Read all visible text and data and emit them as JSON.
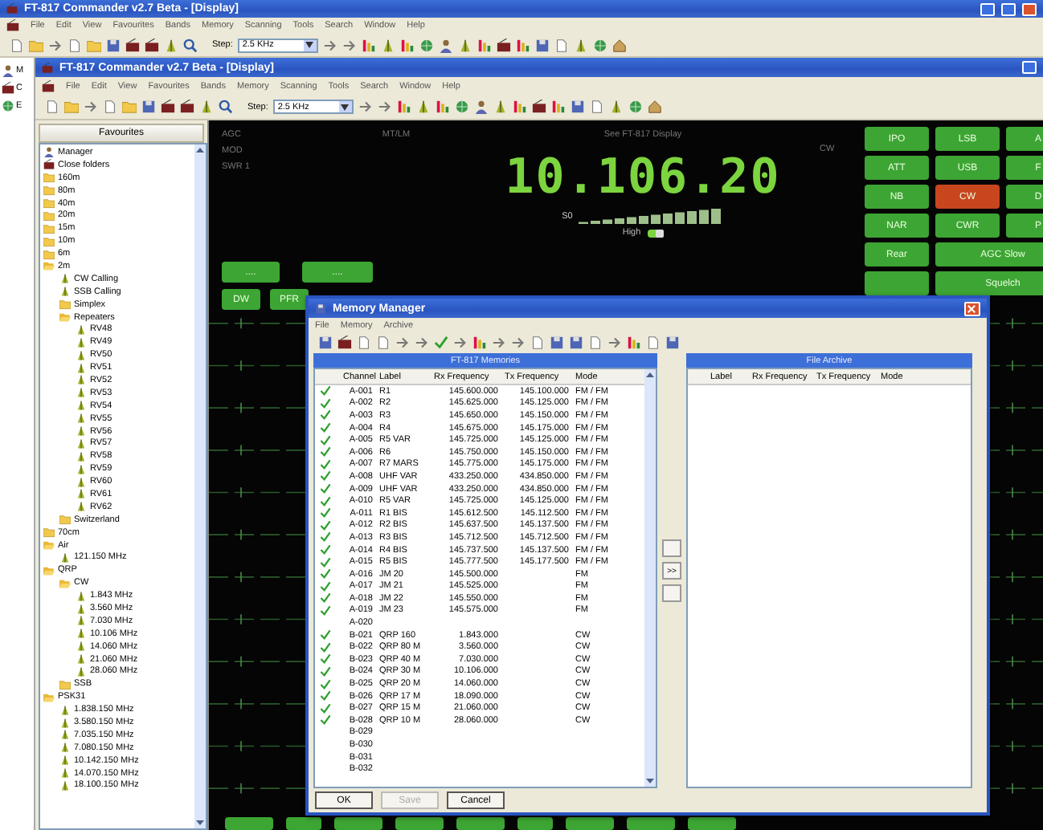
{
  "outer_window": {
    "title": "FT-817 Commander v2.7 Beta - [Display]",
    "menu": [
      "File",
      "Edit",
      "View",
      "Favourites",
      "Bands",
      "Memory",
      "Scanning",
      "Tools",
      "Search",
      "Window",
      "Help"
    ],
    "step": {
      "label": "Step:",
      "value": "2.5 KHz"
    }
  },
  "side_strip": [
    "M",
    "C",
    "E"
  ],
  "inner_window": {
    "title": "FT-817 Commander v2.7 Beta - [Display]",
    "menu": [
      "File",
      "Edit",
      "View",
      "Favourites",
      "Bands",
      "Memory",
      "Scanning",
      "Tools",
      "Search",
      "Window",
      "Help"
    ],
    "step": {
      "label": "Step:",
      "value": "2.5 KHz"
    }
  },
  "favourites": {
    "title": "Favourites",
    "items": [
      {
        "label": "Manager",
        "kind": "manager"
      },
      {
        "label": "Close folders",
        "kind": "action"
      },
      {
        "label": "160m",
        "kind": "folder",
        "expanded": false
      },
      {
        "label": "80m",
        "kind": "folder",
        "expanded": false
      },
      {
        "label": "40m",
        "kind": "folder",
        "expanded": false
      },
      {
        "label": "20m",
        "kind": "folder",
        "expanded": false
      },
      {
        "label": "15m",
        "kind": "folder",
        "expanded": false
      },
      {
        "label": "10m",
        "kind": "folder",
        "expanded": false
      },
      {
        "label": "6m",
        "kind": "folder",
        "expanded": false
      },
      {
        "label": "2m",
        "kind": "folder",
        "expanded": true,
        "children": [
          {
            "label": "CW Calling",
            "kind": "channel"
          },
          {
            "label": "SSB Calling",
            "kind": "channel"
          },
          {
            "label": "Simplex",
            "kind": "folder",
            "expanded": false
          },
          {
            "label": "Repeaters",
            "kind": "folder",
            "expanded": true,
            "children": [
              {
                "label": "RV48",
                "kind": "channel"
              },
              {
                "label": "RV49",
                "kind": "channel"
              },
              {
                "label": "RV50",
                "kind": "channel"
              },
              {
                "label": "RV51",
                "kind": "channel"
              },
              {
                "label": "RV52",
                "kind": "channel"
              },
              {
                "label": "RV53",
                "kind": "channel"
              },
              {
                "label": "RV54",
                "kind": "channel"
              },
              {
                "label": "RV55",
                "kind": "channel"
              },
              {
                "label": "RV56",
                "kind": "channel"
              },
              {
                "label": "RV57",
                "kind": "channel"
              },
              {
                "label": "RV58",
                "kind": "channel"
              },
              {
                "label": "RV59",
                "kind": "channel"
              },
              {
                "label": "RV60",
                "kind": "channel"
              },
              {
                "label": "RV61",
                "kind": "channel"
              },
              {
                "label": "RV62",
                "kind": "channel"
              }
            ]
          },
          {
            "label": "Switzerland",
            "kind": "folder",
            "expanded": false
          }
        ]
      },
      {
        "label": "70cm",
        "kind": "folder",
        "expanded": false
      },
      {
        "label": "Air",
        "kind": "folder",
        "expanded": true,
        "children": [
          {
            "label": "121.150 MHz",
            "kind": "channel"
          }
        ]
      },
      {
        "label": "QRP",
        "kind": "folder",
        "expanded": true,
        "children": [
          {
            "label": "CW",
            "kind": "folder",
            "expanded": true,
            "children": [
              {
                "label": "1.843 MHz",
                "kind": "channel"
              },
              {
                "label": "3.560 MHz",
                "kind": "channel"
              },
              {
                "label": "7.030 MHz",
                "kind": "channel"
              },
              {
                "label": "10.106 MHz",
                "kind": "channel"
              },
              {
                "label": "14.060 MHz",
                "kind": "channel"
              },
              {
                "label": "21.060 MHz",
                "kind": "channel"
              },
              {
                "label": "28.060 MHz",
                "kind": "channel"
              }
            ]
          },
          {
            "label": "SSB",
            "kind": "folder",
            "expanded": false
          }
        ]
      },
      {
        "label": "PSK31",
        "kind": "folder",
        "expanded": true,
        "children": [
          {
            "label": "1.838.150 MHz",
            "kind": "channel"
          },
          {
            "label": "3.580.150 MHz",
            "kind": "channel"
          },
          {
            "label": "7.035.150 MHz",
            "kind": "channel"
          },
          {
            "label": "7.080.150 MHz",
            "kind": "channel"
          },
          {
            "label": "10.142.150 MHz",
            "kind": "channel"
          },
          {
            "label": "14.070.150 MHz",
            "kind": "channel"
          },
          {
            "label": "18.100.150 MHz",
            "kind": "channel"
          }
        ]
      }
    ]
  },
  "display": {
    "labels": [
      "AGC",
      "MOD",
      "SWR 1"
    ],
    "meter_label": "MT/LM",
    "note": "See FT-817 Display",
    "mode": "CW",
    "frequency": "10.106.20",
    "smeter": "S0",
    "power": {
      "label": "High",
      "on": true
    },
    "left_buttons": [
      "....",
      "...."
    ],
    "lower_buttons": [
      "DW",
      "PFR"
    ],
    "function_buttons": [
      {
        "label": "IPO",
        "active": false,
        "wide": false
      },
      {
        "label": "LSB",
        "active": false,
        "wide": false
      },
      {
        "label": "A",
        "active": false,
        "wide": false
      },
      {
        "label": "ATT",
        "active": false,
        "wide": false
      },
      {
        "label": "USB",
        "active": false,
        "wide": false
      },
      {
        "label": "F",
        "active": false,
        "wide": false
      },
      {
        "label": "NB",
        "active": false,
        "wide": false
      },
      {
        "label": "CW",
        "active": true,
        "wide": false
      },
      {
        "label": "D",
        "active": false,
        "wide": false
      },
      {
        "label": "NAR",
        "active": false,
        "wide": false
      },
      {
        "label": "CWR",
        "active": false,
        "wide": false
      },
      {
        "label": "P",
        "active": false,
        "wide": false
      },
      {
        "label": "Rear",
        "active": false,
        "wide": false
      },
      {
        "label": "AGC Slow",
        "active": false,
        "wide": true
      },
      {
        "active": false,
        "wide": false
      },
      {
        "label": "Squelch",
        "active": false,
        "wide": true
      }
    ]
  },
  "memory_manager": {
    "title": "Memory Manager",
    "menu": [
      "File",
      "Memory",
      "Archive"
    ],
    "memories": {
      "title": "FT-817 Memories",
      "columns": [
        "Channel",
        "Label",
        "Rx Frequency",
        "Tx Frequency",
        "Mode"
      ],
      "rows": [
        {
          "checked": true,
          "channel": "A-001",
          "label": "R1",
          "rx": "145.600.000",
          "tx": "145.100.000",
          "mode": "FM / FM"
        },
        {
          "checked": true,
          "channel": "A-002",
          "label": "R2",
          "rx": "145.625.000",
          "tx": "145.125.000",
          "mode": "FM / FM"
        },
        {
          "checked": true,
          "channel": "A-003",
          "label": "R3",
          "rx": "145.650.000",
          "tx": "145.150.000",
          "mode": "FM / FM"
        },
        {
          "checked": true,
          "channel": "A-004",
          "label": "R4",
          "rx": "145.675.000",
          "tx": "145.175.000",
          "mode": "FM / FM"
        },
        {
          "checked": true,
          "channel": "A-005",
          "label": "R5 VAR",
          "rx": "145.725.000",
          "tx": "145.125.000",
          "mode": "FM / FM"
        },
        {
          "checked": true,
          "channel": "A-006",
          "label": "R6",
          "rx": "145.750.000",
          "tx": "145.150.000",
          "mode": "FM / FM"
        },
        {
          "checked": true,
          "channel": "A-007",
          "label": "R7 MARS",
          "rx": "145.775.000",
          "tx": "145.175.000",
          "mode": "FM / FM"
        },
        {
          "checked": true,
          "channel": "A-008",
          "label": "UHF VAR",
          "rx": "433.250.000",
          "tx": "434.850.000",
          "mode": "FM / FM"
        },
        {
          "checked": true,
          "channel": "A-009",
          "label": "UHF VAR",
          "rx": "433.250.000",
          "tx": "434.850.000",
          "mode": "FM / FM"
        },
        {
          "checked": true,
          "channel": "A-010",
          "label": "R5 VAR",
          "rx": "145.725.000",
          "tx": "145.125.000",
          "mode": "FM / FM"
        },
        {
          "checked": true,
          "channel": "A-011",
          "label": "R1 BIS",
          "rx": "145.612.500",
          "tx": "145.112.500",
          "mode": "FM / FM"
        },
        {
          "checked": true,
          "channel": "A-012",
          "label": "R2 BIS",
          "rx": "145.637.500",
          "tx": "145.137.500",
          "mode": "FM / FM"
        },
        {
          "checked": true,
          "channel": "A-013",
          "label": "R3 BIS",
          "rx": "145.712.500",
          "tx": "145.712.500",
          "mode": "FM / FM"
        },
        {
          "checked": true,
          "channel": "A-014",
          "label": "R4 BIS",
          "rx": "145.737.500",
          "tx": "145.137.500",
          "mode": "FM / FM"
        },
        {
          "checked": true,
          "channel": "A-015",
          "label": "R5 BIS",
          "rx": "145.777.500",
          "tx": "145.177.500",
          "mode": "FM / FM"
        },
        {
          "checked": true,
          "channel": "A-016",
          "label": "JM 20",
          "rx": "145.500.000",
          "mode": "FM"
        },
        {
          "checked": true,
          "channel": "A-017",
          "label": "JM 21",
          "rx": "145.525.000",
          "mode": "FM"
        },
        {
          "checked": true,
          "channel": "A-018",
          "label": "JM 22",
          "rx": "145.550.000",
          "mode": "FM"
        },
        {
          "checked": true,
          "channel": "A-019",
          "label": "JM 23",
          "rx": "145.575.000",
          "mode": "FM"
        },
        {
          "checked": false,
          "channel": "A-020"
        },
        {
          "checked": true,
          "channel": "B-021",
          "label": "QRP 160",
          "rx": "1.843.000",
          "mode": "CW"
        },
        {
          "checked": true,
          "channel": "B-022",
          "label": "QRP 80 M",
          "rx": "3.560.000",
          "mode": "CW"
        },
        {
          "checked": true,
          "channel": "B-023",
          "label": "QRP 40 M",
          "rx": "7.030.000",
          "mode": "CW"
        },
        {
          "checked": true,
          "channel": "B-024",
          "label": "QRP 30 M",
          "rx": "10.106.000",
          "mode": "CW"
        },
        {
          "checked": true,
          "channel": "B-025",
          "label": "QRP 20 M",
          "rx": "14.060.000",
          "mode": "CW"
        },
        {
          "checked": true,
          "channel": "B-026",
          "label": "QRP 17 M",
          "rx": "18.090.000",
          "mode": "CW"
        },
        {
          "checked": true,
          "channel": "B-027",
          "label": "QRP 15 M",
          "rx": "21.060.000",
          "mode": "CW"
        },
        {
          "checked": true,
          "channel": "B-028",
          "label": "QRP 10 M",
          "rx": "28.060.000",
          "mode": "CW"
        },
        {
          "checked": false,
          "channel": "B-029"
        },
        {
          "checked": false,
          "channel": "B-030"
        },
        {
          "checked": false,
          "channel": "B-031"
        },
        {
          "checked": false,
          "channel": "B-032"
        }
      ]
    },
    "transfer": ">>",
    "archive": {
      "title": "File Archive",
      "columns": [
        "Label",
        "Rx Frequency",
        "Tx Frequency",
        "Mode"
      ]
    },
    "buttons": [
      {
        "label": "OK",
        "disabled": false
      },
      {
        "label": "Save",
        "disabled": true
      },
      {
        "label": "Cancel",
        "disabled": false
      }
    ]
  }
}
